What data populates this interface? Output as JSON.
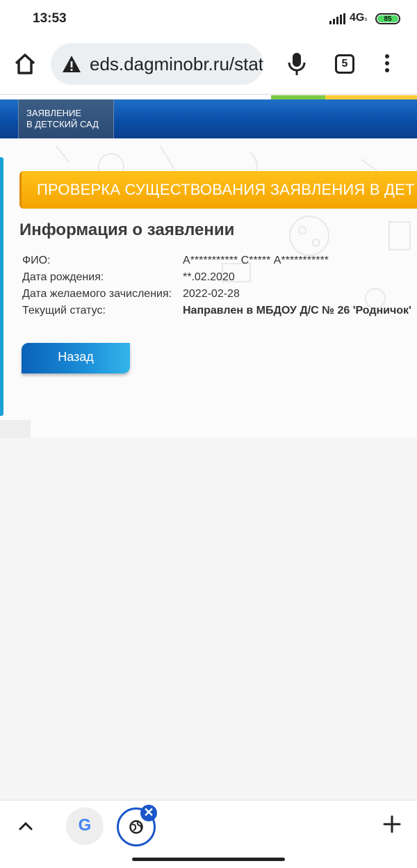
{
  "status_bar": {
    "time": "13:53",
    "network": "4G",
    "network_sub": "s",
    "battery": "85"
  },
  "browser": {
    "url": "eds.dagminobr.ru/stat",
    "tab_count": "5"
  },
  "site": {
    "logo_line1": "ЗАЯВЛЕНИЕ",
    "logo_line2": "В ДЕТСКИЙ САД",
    "banner_title": "ПРОВЕРКА СУЩЕСТВОВАНИЯ ЗАЯВЛЕНИЯ В ДЕТ"
  },
  "info": {
    "heading": "Информация о заявлении",
    "rows": [
      {
        "label": "ФИО:",
        "value": "А*********** С***** А***********"
      },
      {
        "label": "Дата рождения:",
        "value": "**.02.2020"
      },
      {
        "label": "Дата желаемого зачисления:",
        "value": "2022-02-28"
      },
      {
        "label": "Текущий статус:",
        "value": "Направлен в МБДОУ Д/С № 26 'Родничок'"
      }
    ],
    "back_button": "Назад"
  },
  "bottom_bar": {
    "google_letter": "G",
    "close_glyph": "✕"
  },
  "colors": {
    "header_blue": "#0a4ea8",
    "banner_orange": "#f5a300",
    "accent_blue": "#1a56c9",
    "battery_green": "#4cd964"
  }
}
